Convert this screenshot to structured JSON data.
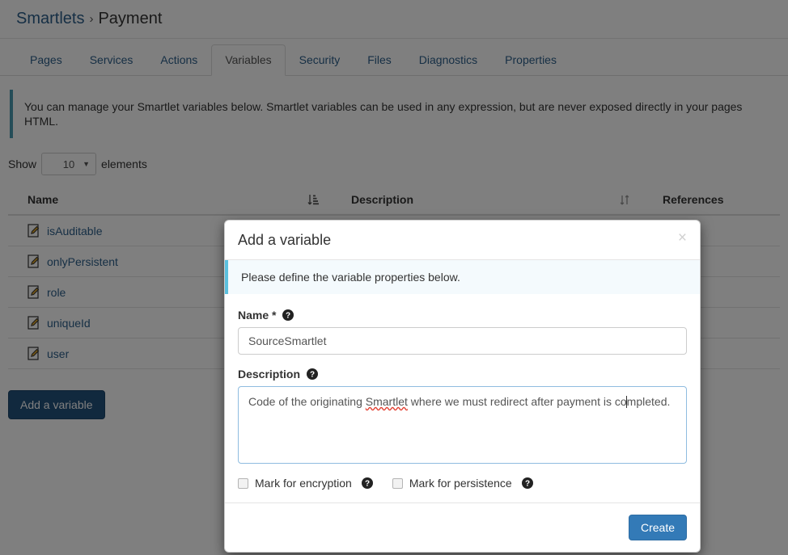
{
  "breadcrumb": {
    "root": "Smartlets",
    "separator": "›",
    "current": "Payment"
  },
  "tabs": [
    {
      "label": "Pages",
      "active": false
    },
    {
      "label": "Services",
      "active": false
    },
    {
      "label": "Actions",
      "active": false
    },
    {
      "label": "Variables",
      "active": true
    },
    {
      "label": "Security",
      "active": false
    },
    {
      "label": "Files",
      "active": false
    },
    {
      "label": "Diagnostics",
      "active": false
    },
    {
      "label": "Properties",
      "active": false
    }
  ],
  "page_alert": {
    "text": "You can manage your Smartlet variables below. Smartlet variables can be used in any expression, but are never exposed directly in your pages HTML.",
    "accent_color": "#4a9bb0"
  },
  "length_menu": {
    "prefix": "Show",
    "value": "10",
    "suffix": "elements",
    "caret_icon": "chevron-down-icon"
  },
  "table": {
    "columns": [
      {
        "label": "Name",
        "sort_icon": "sort-amount-asc-icon",
        "sorted": true
      },
      {
        "label": "Description",
        "sort_icon": "sort-unsorted-icon",
        "sorted": false
      },
      {
        "label": "References",
        "sort_icon": null,
        "sorted": false
      }
    ],
    "rows": [
      {
        "icon": "edit-document-icon",
        "name": "isAuditable",
        "description": "",
        "references": ""
      },
      {
        "icon": "edit-document-icon",
        "name": "onlyPersistent",
        "description": "",
        "references": ""
      },
      {
        "icon": "edit-document-icon",
        "name": "role",
        "description": "",
        "references": ""
      },
      {
        "icon": "edit-document-icon",
        "name": "uniqueId",
        "description": "",
        "references": ""
      },
      {
        "icon": "edit-document-icon",
        "name": "user",
        "description": "",
        "references": ""
      }
    ]
  },
  "add_variable_button": {
    "label": "Add a variable",
    "color": "#23527c"
  },
  "modal": {
    "title": "Add a variable",
    "close_icon": "close-icon",
    "close_label": "×",
    "alert": {
      "text": "Please define the variable properties below.",
      "accent_color": "#5bc0de",
      "background": "#f4fafd"
    },
    "name_field": {
      "label": "Name *",
      "help_icon": "help-circle-icon",
      "value": "SourceSmartlet",
      "placeholder": ""
    },
    "description_field": {
      "label": "Description",
      "help_icon": "help-circle-icon",
      "value_before_caret": "Code of the originating ",
      "value_misspelled": "Smartlet",
      "value_after_misspelled": " where we must redirect after payment is co",
      "value_after_caret": "mpleted.",
      "full_value": "Code of the originating Smartlet where we must redirect after payment is completed.",
      "placeholder": ""
    },
    "checkboxes": [
      {
        "label": "Mark for encryption",
        "checked": false,
        "help_icon": "help-circle-icon"
      },
      {
        "label": "Mark for persistence",
        "checked": false,
        "help_icon": "help-circle-icon"
      }
    ],
    "submit_button": {
      "label": "Create",
      "color": "#337ab7"
    }
  }
}
